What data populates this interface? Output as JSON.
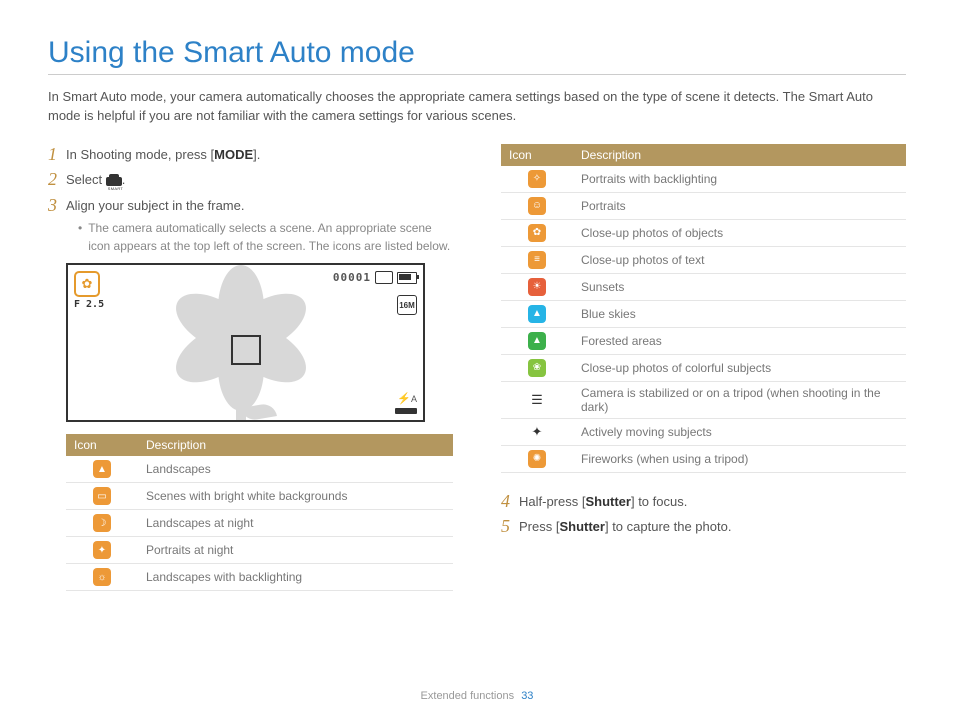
{
  "title": "Using the Smart Auto mode",
  "intro": "In Smart Auto mode, your camera automatically chooses the appropriate camera settings based on the type of scene it detects. The Smart Auto mode is helpful if you are not familiar with the camera settings for various scenes.",
  "steps": {
    "s1_pre": "In Shooting mode, press [",
    "s1_btn": "MODE",
    "s1_post": "].",
    "s2_pre": "Select ",
    "s2_post": ".",
    "s3": "Align your subject in the frame.",
    "s3_bullet": "The camera automatically selects a scene. An appropriate scene icon appears at the top left of the screen. The icons are listed below.",
    "s4_pre": "Half-press [",
    "s4_btn": "Shutter",
    "s4_post": "] to focus.",
    "s5_pre": "Press [",
    "s5_btn": "Shutter",
    "s5_post": "] to capture the photo."
  },
  "camera_overlay": {
    "f_value": "F 2.5",
    "counter": "00001",
    "size_indicator": "16M",
    "flash": "A"
  },
  "table_headers": {
    "icon": "Icon",
    "desc": "Description"
  },
  "left_table": [
    {
      "desc": "Landscapes",
      "color": "orange",
      "glyph": "▲"
    },
    {
      "desc": "Scenes with bright white backgrounds",
      "color": "orange",
      "glyph": "▭"
    },
    {
      "desc": "Landscapes at night",
      "color": "orange",
      "glyph": "☽"
    },
    {
      "desc": "Portraits at night",
      "color": "orange",
      "glyph": "✦"
    },
    {
      "desc": "Landscapes with backlighting",
      "color": "orange",
      "glyph": "☼"
    }
  ],
  "right_table": [
    {
      "desc": "Portraits with backlighting",
      "color": "orange",
      "glyph": "✧"
    },
    {
      "desc": "Portraits",
      "color": "orange",
      "glyph": "☺"
    },
    {
      "desc": "Close-up photos of objects",
      "color": "orange",
      "glyph": "✿"
    },
    {
      "desc": "Close-up photos of text",
      "color": "orange",
      "glyph": "≡"
    },
    {
      "desc": "Sunsets",
      "color": "red",
      "glyph": "☀"
    },
    {
      "desc": "Blue skies",
      "color": "blue",
      "glyph": "▲"
    },
    {
      "desc": "Forested areas",
      "color": "greenD",
      "glyph": "▲"
    },
    {
      "desc": "Close-up photos of colorful subjects",
      "color": "greenL",
      "glyph": "❀"
    },
    {
      "desc": "Camera is stabilized or on a tripod (when shooting in the dark)",
      "color": "white",
      "glyph": "☰"
    },
    {
      "desc": "Actively moving subjects",
      "color": "white",
      "glyph": "✦"
    },
    {
      "desc": "Fireworks (when using a tripod)",
      "color": "orange",
      "glyph": "✺"
    }
  ],
  "footer": {
    "section": "Extended functions",
    "page": "33"
  }
}
